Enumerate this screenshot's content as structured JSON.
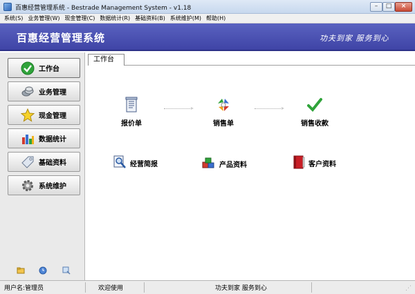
{
  "window": {
    "title": "百惠经营管理系统 - Bestrade Management System - v1.18"
  },
  "menu": [
    {
      "label": "系统(S)"
    },
    {
      "label": "业务管理(W)"
    },
    {
      "label": "现金管理(C)"
    },
    {
      "label": "数据统计(R)"
    },
    {
      "label": "基础资料(B)"
    },
    {
      "label": "系统维护(M)"
    },
    {
      "label": "帮助(H)"
    }
  ],
  "banner": {
    "title": "百惠经营管理系统",
    "slogan": "功夫到家 服务到心"
  },
  "sidebar": {
    "items": [
      {
        "label": "工作台",
        "icon": "green-check-icon"
      },
      {
        "label": "业务管理",
        "icon": "coins-icon"
      },
      {
        "label": "现金管理",
        "icon": "star-icon"
      },
      {
        "label": "数据统计",
        "icon": "bar-chart-icon"
      },
      {
        "label": "基础资料",
        "icon": "tag-icon"
      },
      {
        "label": "系统维护",
        "icon": "gear-icon"
      }
    ],
    "tools": [
      "folder-icon",
      "clock-icon",
      "search-icon"
    ]
  },
  "content": {
    "tab_label": "工作台",
    "functions": [
      {
        "label": "报价单",
        "icon": "document-icon"
      },
      {
        "label": "销售单",
        "icon": "recycle-arrows-icon"
      },
      {
        "label": "销售收款",
        "icon": "green-check-icon"
      },
      {
        "label": "经营简报",
        "icon": "magnifier-report-icon"
      },
      {
        "label": "产品资料",
        "icon": "cubes-icon"
      },
      {
        "label": "客户资料",
        "icon": "red-book-icon"
      }
    ]
  },
  "status": {
    "user": "用户名:管理员",
    "welcome": "欢迎使用",
    "slogan": "功夫到家 服务到心"
  },
  "colors": {
    "banner": "#4a50b2",
    "sidebar": "#eaeaea",
    "accent_green": "#2fa33a",
    "accent_red": "#c81d25"
  }
}
